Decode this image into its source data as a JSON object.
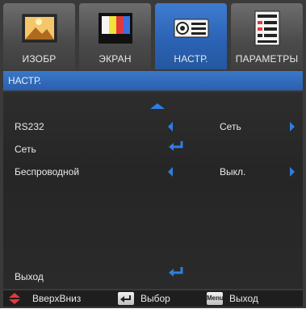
{
  "tabs": [
    {
      "label": "ИЗОБР",
      "icon": "picture-icon",
      "active": false
    },
    {
      "label": "ЭКРАН",
      "icon": "screen-icon",
      "active": false
    },
    {
      "label": "НАСТР.",
      "icon": "projector-icon",
      "active": true
    },
    {
      "label": "ПАРАМЕТРЫ",
      "icon": "options-icon",
      "active": false
    }
  ],
  "title": "НАСТР.",
  "menu": {
    "rs232": {
      "label": "RS232",
      "value": "Сеть"
    },
    "network": {
      "label": "Сеть"
    },
    "wireless": {
      "label": "Беспроводной",
      "value": "Выкл."
    },
    "exit": {
      "label": "Выход"
    }
  },
  "footer": {
    "updown": "ВверхВниз",
    "select": "Выбор",
    "menu_key": "Menu",
    "exit": "Выход"
  },
  "colors": {
    "accent": "#2c7fe0",
    "active_tab": "#2a61b3"
  }
}
